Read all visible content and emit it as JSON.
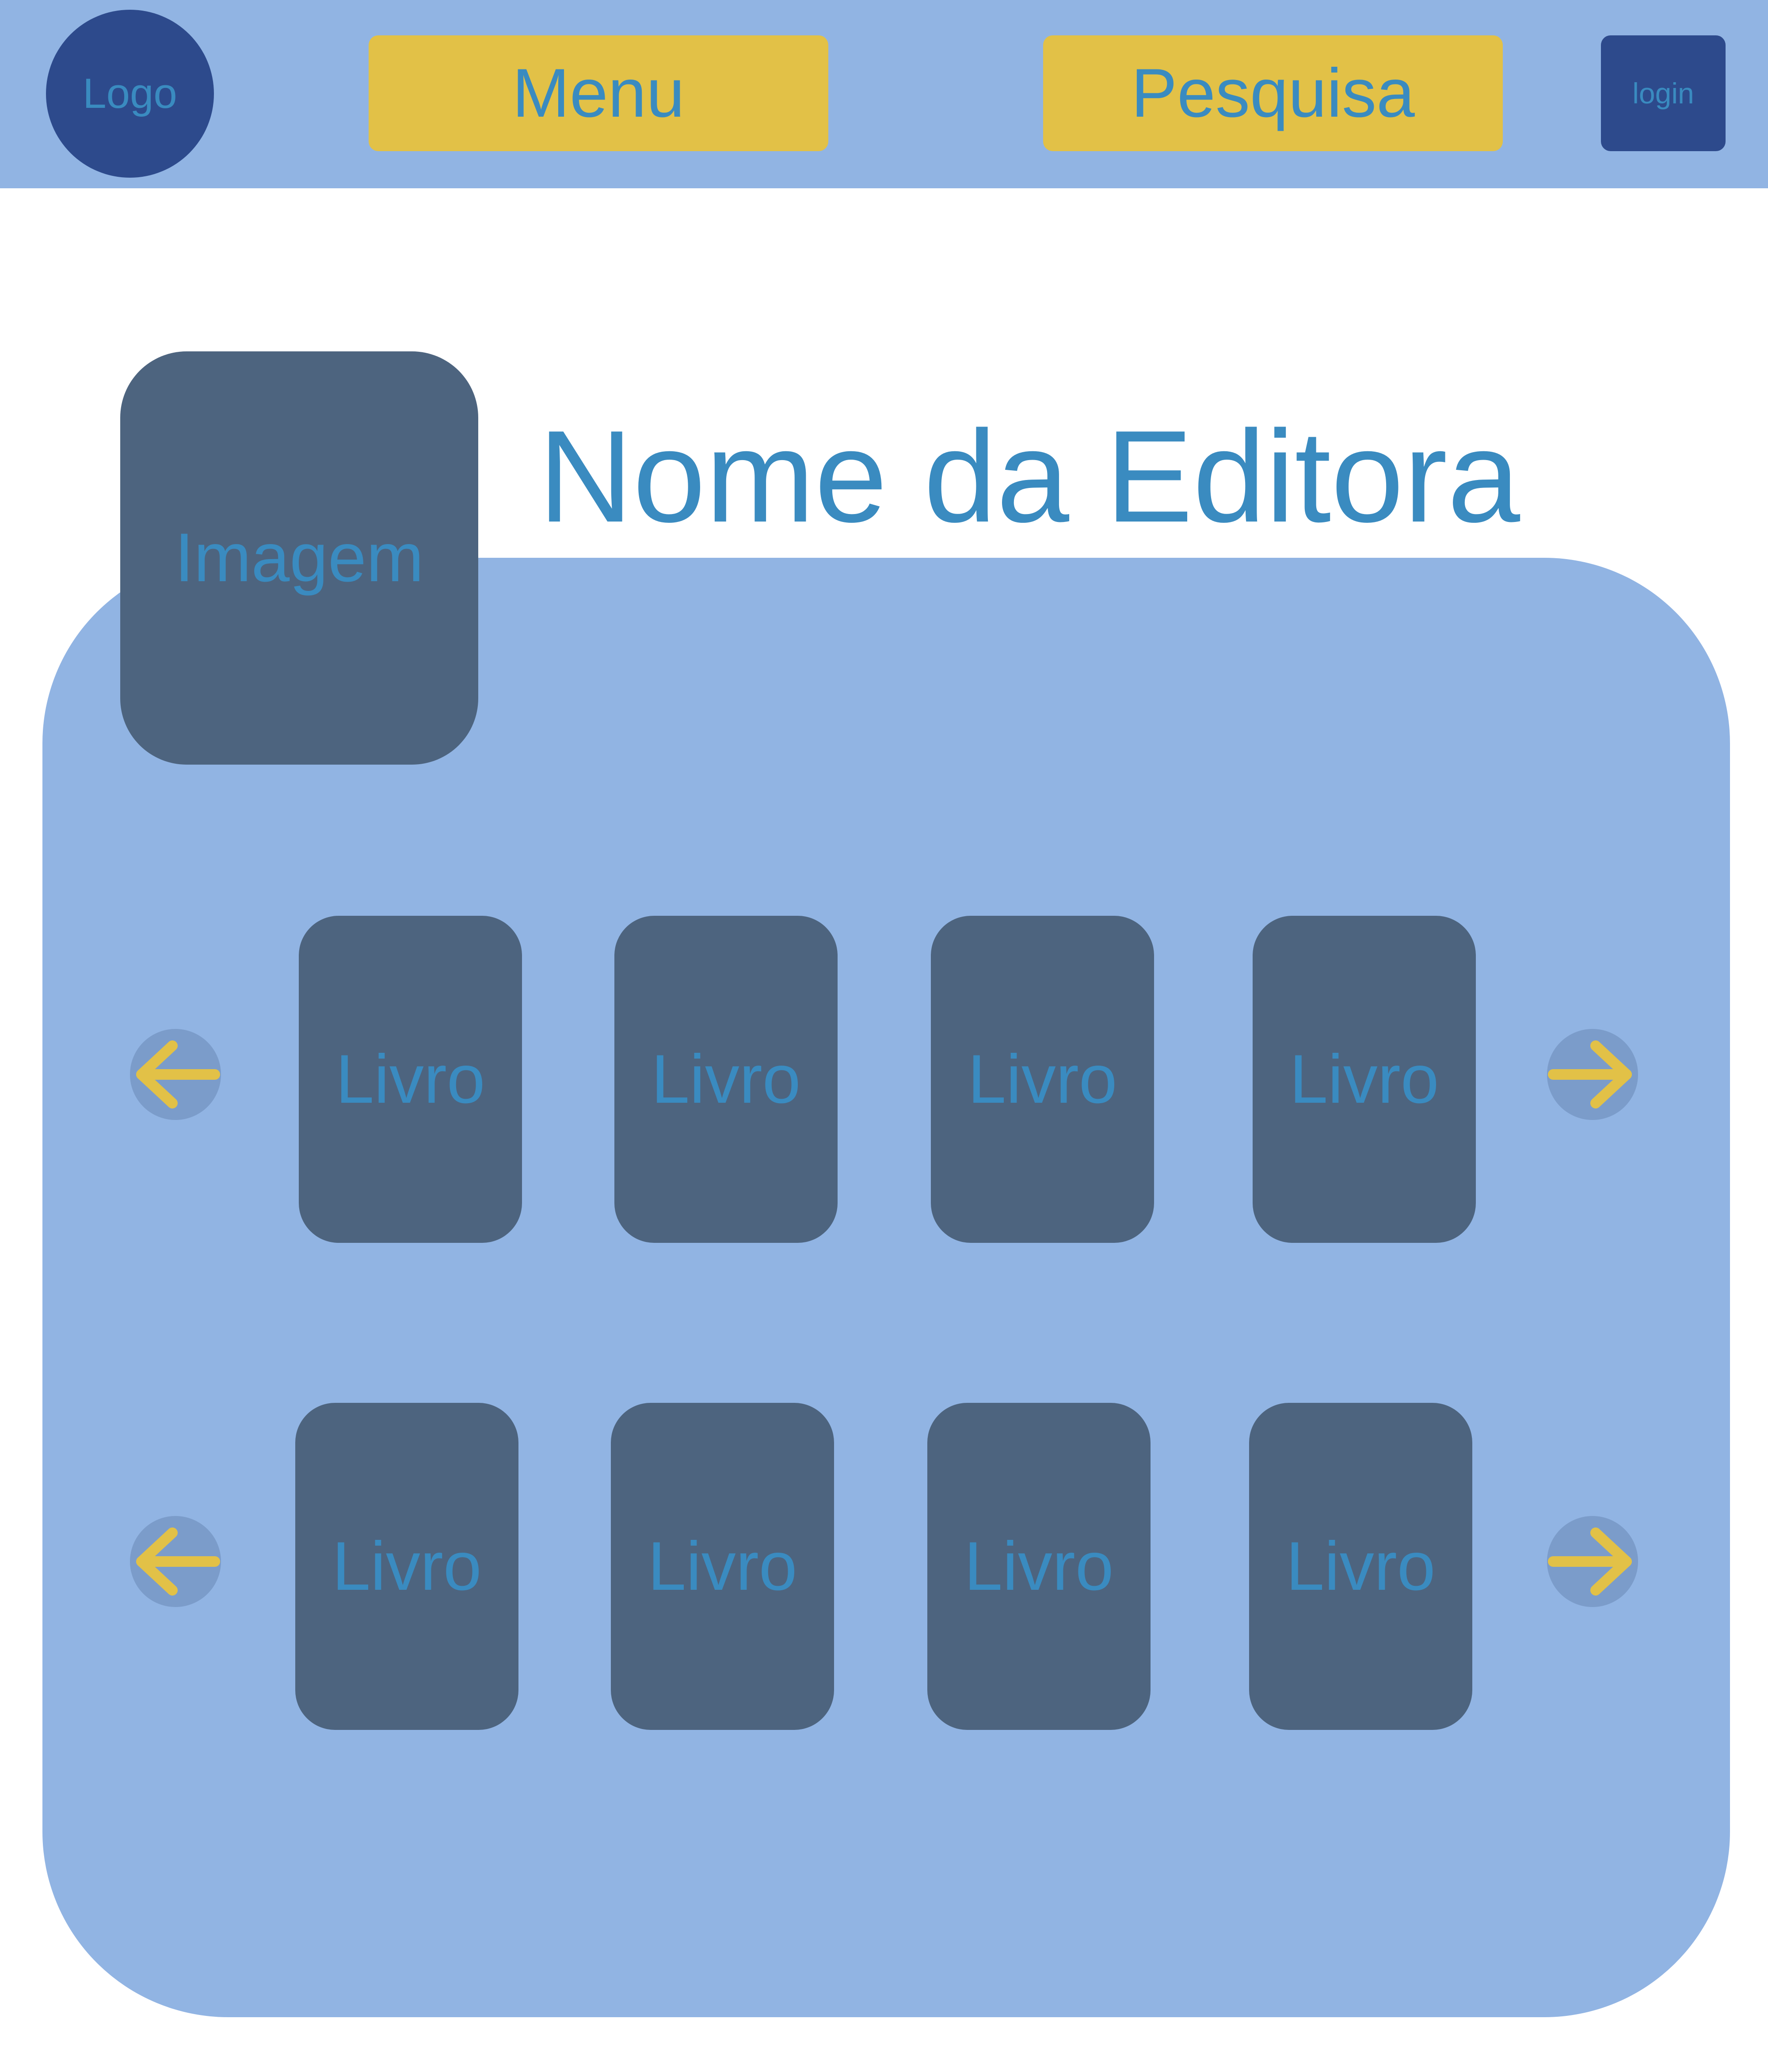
{
  "header": {
    "logo_label": "Logo",
    "menu_label": "Menu",
    "search_label": "Pesquisa",
    "login_label": "login"
  },
  "publisher": {
    "name": "Nome da Editora",
    "image_label": "Imagem"
  },
  "carousels": [
    {
      "books": [
        "Livro",
        "Livro",
        "Livro",
        "Livro"
      ]
    },
    {
      "books": [
        "Livro",
        "Livro",
        "Livro",
        "Livro"
      ]
    }
  ],
  "colors": {
    "header_bg": "#91b4e3",
    "panel_bg": "#91b4e3",
    "accent_yellow": "#e2c147",
    "dark_blue": "#2d4a8c",
    "card_slate": "#4d647f",
    "text_blue": "#3a8bc0"
  },
  "icons": {
    "prev": "arrow-left-icon",
    "next": "arrow-right-icon"
  }
}
